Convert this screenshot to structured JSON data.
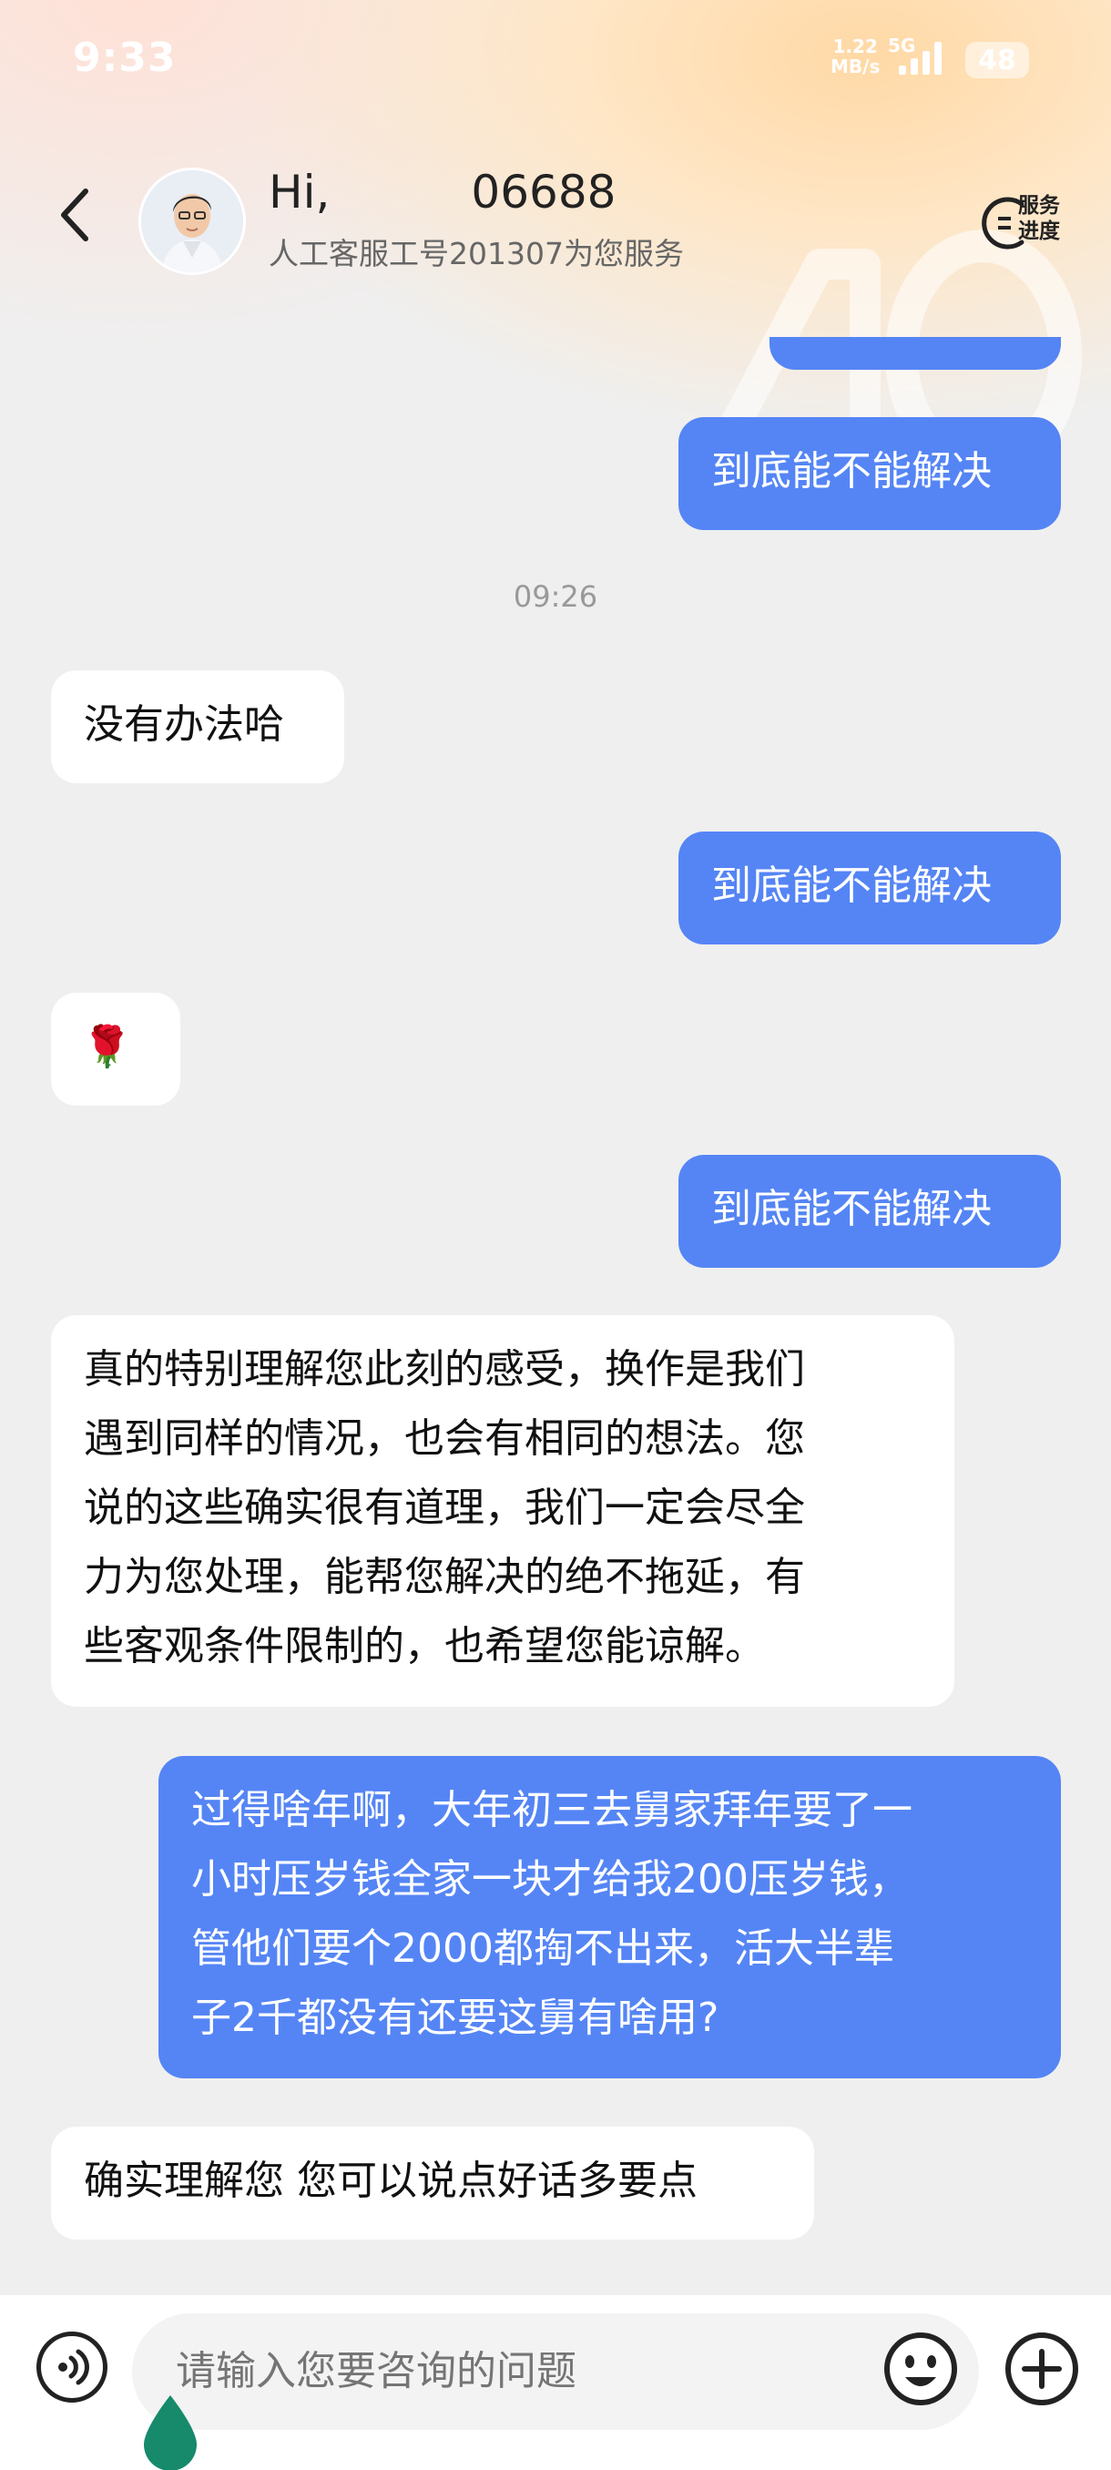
{
  "status_bar": {
    "time": "9:33",
    "net_speed_value": "1.22",
    "net_speed_unit": "MB/s",
    "net_type": "5G",
    "battery": "48"
  },
  "header": {
    "greeting": "Hi,",
    "user_suffix": "06688",
    "subtitle": "人工客服工号201307为您服务",
    "progress_line1": "服务",
    "progress_line2": "进度"
  },
  "messages": [
    {
      "from": "me",
      "text": "到底能不能解决"
    },
    {
      "type": "timestamp",
      "text": "09:26"
    },
    {
      "from": "agent",
      "text": "没有办法哈"
    },
    {
      "from": "me",
      "text": "到底能不能解决"
    },
    {
      "from": "agent",
      "text": "🌹"
    },
    {
      "from": "me",
      "text": "到底能不能解决"
    },
    {
      "from": "agent",
      "lines": [
        "真的特别理解您此刻的感受，换作是我们",
        "遇到同样的情况，也会有相同的想法。您",
        "说的这些确实很有道理，我们一定会尽全",
        "力为您处理，能帮您解决的绝不拖延，有",
        "些客观条件限制的，也希望您能谅解。"
      ]
    },
    {
      "from": "me",
      "lines": [
        "过得啥年啊，大年初三去舅家拜年要了一",
        "小时压岁钱全家一块才给我200压岁钱，",
        "管他们要个2000都掏不出来，活大半辈",
        "子2千都没有还要这舅有啥用?"
      ]
    },
    {
      "from": "agent",
      "text": "确实理解您 您可以说点好话多要点"
    }
  ],
  "input": {
    "placeholder": "请输入您要咨询的问题"
  },
  "colors": {
    "my_bubble": "#5585f5",
    "agent_bubble": "#ffffff",
    "background": "#efefef"
  }
}
